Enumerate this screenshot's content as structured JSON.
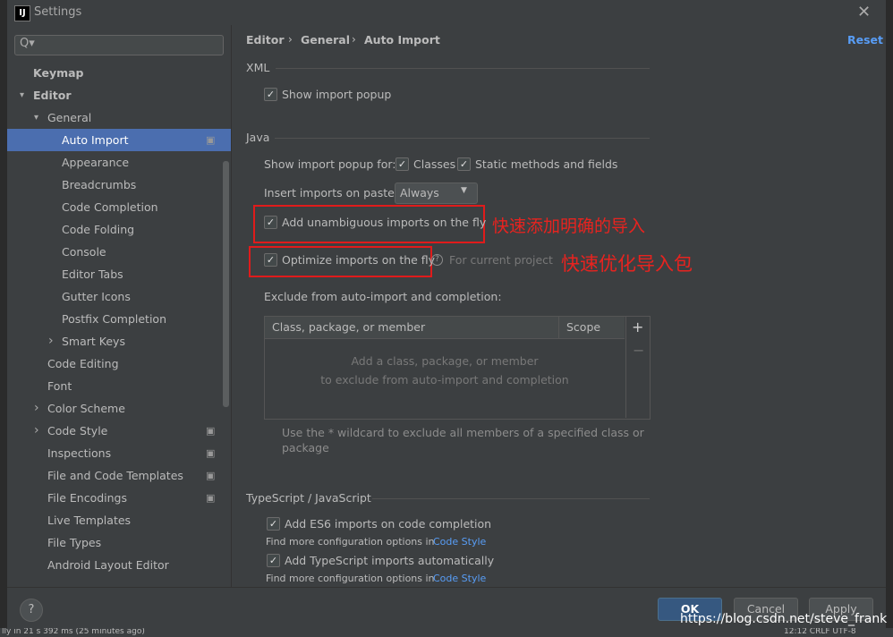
{
  "window": {
    "title": "Settings",
    "logo": "IJ"
  },
  "search": {
    "placeholder": "Q▾"
  },
  "sidebar": {
    "items": [
      {
        "label": "Keymap",
        "indent": 0,
        "bold": true
      },
      {
        "label": "Editor",
        "indent": 0,
        "bold": true,
        "expanded": true
      },
      {
        "label": "General",
        "indent": 1,
        "expanded": true
      },
      {
        "label": "Auto Import",
        "indent": 2,
        "selected": true,
        "gear": true
      },
      {
        "label": "Appearance",
        "indent": 2
      },
      {
        "label": "Breadcrumbs",
        "indent": 2
      },
      {
        "label": "Code Completion",
        "indent": 2
      },
      {
        "label": "Code Folding",
        "indent": 2
      },
      {
        "label": "Console",
        "indent": 2
      },
      {
        "label": "Editor Tabs",
        "indent": 2
      },
      {
        "label": "Gutter Icons",
        "indent": 2
      },
      {
        "label": "Postfix Completion",
        "indent": 2
      },
      {
        "label": "Smart Keys",
        "indent": 2,
        "collapsed": true
      },
      {
        "label": "Code Editing",
        "indent": 1
      },
      {
        "label": "Font",
        "indent": 1
      },
      {
        "label": "Color Scheme",
        "indent": 1,
        "collapsed": true
      },
      {
        "label": "Code Style",
        "indent": 1,
        "collapsed": true,
        "gear": true
      },
      {
        "label": "Inspections",
        "indent": 1,
        "gear": true
      },
      {
        "label": "File and Code Templates",
        "indent": 1,
        "gear": true
      },
      {
        "label": "File Encodings",
        "indent": 1,
        "gear": true
      },
      {
        "label": "Live Templates",
        "indent": 1
      },
      {
        "label": "File Types",
        "indent": 1
      },
      {
        "label": "Android Layout Editor",
        "indent": 1
      }
    ]
  },
  "breadcrumb": {
    "part1": "Editor",
    "part2": "General",
    "part3": "Auto Import",
    "sep": "›"
  },
  "reset_label": "Reset",
  "xml": {
    "title": "XML",
    "show_import_popup": "Show import popup"
  },
  "java": {
    "title": "Java",
    "show_popup_for": "Show import popup for:",
    "classes": "Classes",
    "static_methods": "Static methods and fields",
    "insert_on_paste": "Insert imports on paste:",
    "insert_value": "Always",
    "add_unambiguous": "Add unambiguous imports on the fly",
    "optimize": "Optimize imports on the fly",
    "for_current_project": "For current project",
    "exclude_title": "Exclude from auto-import and completion:",
    "col_class": "Class, package, or member",
    "col_scope": "Scope",
    "empty_line1": "Add a class, package, or member",
    "empty_line2": "to exclude from auto-import and completion",
    "wildcard_line1": "Use the * wildcard to exclude all members of a specified class or",
    "wildcard_line2": "package"
  },
  "annotations": {
    "note1": "快速添加明确的导入",
    "note2": "快速优化导入包"
  },
  "ts": {
    "title": "TypeScript / JavaScript",
    "es6": "Add ES6 imports on code completion",
    "find_more": "Find more configuration options in",
    "code_style": "Code Style",
    "ts_auto": "Add TypeScript imports automatically"
  },
  "buttons": {
    "help": "?",
    "ok": "OK",
    "cancel": "Cancel",
    "apply": "Apply"
  },
  "watermark": "https://blog.csdn.net/steve_frank",
  "status": {
    "left": "lly in 21 s 392 ms (25 minutes ago)",
    "right": "12:12   CRLF   UTF-8"
  },
  "colors": {
    "selection": "#4b6eaf",
    "accent_link": "#589df6",
    "annotation_red": "#e8231f"
  }
}
